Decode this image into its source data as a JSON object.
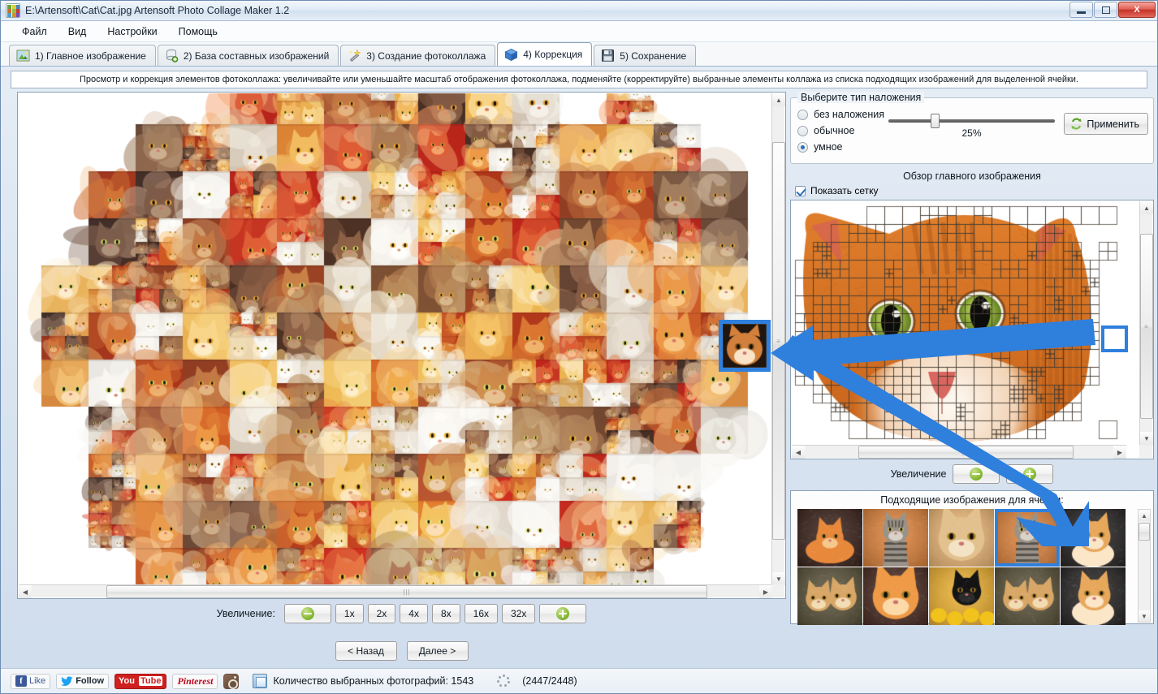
{
  "window": {
    "title": "E:\\Artensoft\\Cat\\Cat.jpg Artensoft Photo Collage Maker 1.2",
    "app_icon": "collage-app-icon",
    "minimize_label": "",
    "restore_label": "",
    "close_label": "X"
  },
  "menu": {
    "items": [
      {
        "label": "Файл",
        "name": "menu-file"
      },
      {
        "label": "Вид",
        "name": "menu-view"
      },
      {
        "label": "Настройки",
        "name": "menu-settings"
      },
      {
        "label": "Помощь",
        "name": "menu-help"
      }
    ]
  },
  "tabs": [
    {
      "label": "1) Главное изображение",
      "icon": "picture-icon",
      "active": false
    },
    {
      "label": "2) База составных изображений",
      "icon": "database-add-icon",
      "active": false
    },
    {
      "label": "3) Создание фотоколлажа",
      "icon": "magic-wand-icon",
      "active": false
    },
    {
      "label": "4) Коррекция",
      "icon": "blue-box-icon",
      "active": true
    },
    {
      "label": "5) Сохранение",
      "icon": "floppy-disk-icon",
      "active": false
    }
  ],
  "instruction": "Просмотр и коррекция элементов фотоколлажа: увеличивайте или уменьшайте масштаб отображения фотоколлажа, подменяйте (корректируйте) выбранные элементы коллажа из списка подходящих изображений для выделенной ячейки.",
  "collage": {
    "zoom_label": "Увеличение:",
    "zoom_levels": [
      "1x",
      "2x",
      "4x",
      "8x",
      "16x",
      "32x"
    ],
    "zoom_out_icon": "zoom-out-icon",
    "zoom_in_icon": "zoom-in-icon"
  },
  "nav": {
    "back_label": "< Назад",
    "next_label": "Далее >"
  },
  "overlay": {
    "group_title": "Выберите тип наложения",
    "options": [
      {
        "label": "без наложения",
        "selected": false
      },
      {
        "label": "обычное",
        "selected": false
      },
      {
        "label": "умное",
        "selected": true
      }
    ],
    "slider_value": "25%",
    "slider_percent": 25,
    "apply_label": "Применить",
    "apply_icon": "recycle-icon"
  },
  "preview": {
    "title": "Обзор главного изображения",
    "show_grid_label": "Показать сетку",
    "show_grid_checked": true,
    "zoom_label": "Увеличение",
    "zoom_out_icon": "zoom-out-icon",
    "zoom_in_icon": "zoom-in-icon"
  },
  "matching": {
    "title": "Подходящие изображения для ячейки:",
    "selected_index": 3,
    "thumbnails": [
      {
        "name": "thumb-orange-cat-dark",
        "seed": 11
      },
      {
        "name": "thumb-tabby-orange-bg",
        "seed": 22
      },
      {
        "name": "thumb-persian-closeup",
        "seed": 33
      },
      {
        "name": "thumb-tabby-orange-bg-2",
        "seed": 44
      },
      {
        "name": "thumb-ginger-kitten-selected",
        "seed": 55
      },
      {
        "name": "thumb-two-kittens",
        "seed": 66
      },
      {
        "name": "thumb-ginger-cat-face",
        "seed": 77
      },
      {
        "name": "thumb-black-cat-sunflower",
        "seed": 88
      },
      {
        "name": "thumb-two-kittens-2",
        "seed": 99
      },
      {
        "name": "thumb-ginger-kitten-2",
        "seed": 110
      }
    ]
  },
  "statusbar": {
    "social": [
      {
        "name": "facebook-like-button",
        "label": "Like"
      },
      {
        "name": "twitter-follow-button",
        "label": "Follow"
      },
      {
        "name": "youtube-button",
        "label": "You",
        "label2": "Tube"
      },
      {
        "name": "pinterest-button",
        "label": "Pinterest"
      },
      {
        "name": "instagram-button",
        "label": ""
      }
    ],
    "photo_count_label": "Количество выбранных фотографий: 1543",
    "progress_label": "(2447/2448)"
  },
  "colors": {
    "accent_blue": "#2f7fdd",
    "titlebar": "#dde9f6",
    "tab_active_bg": "#ffffff",
    "green_button": "#7fb32a"
  }
}
